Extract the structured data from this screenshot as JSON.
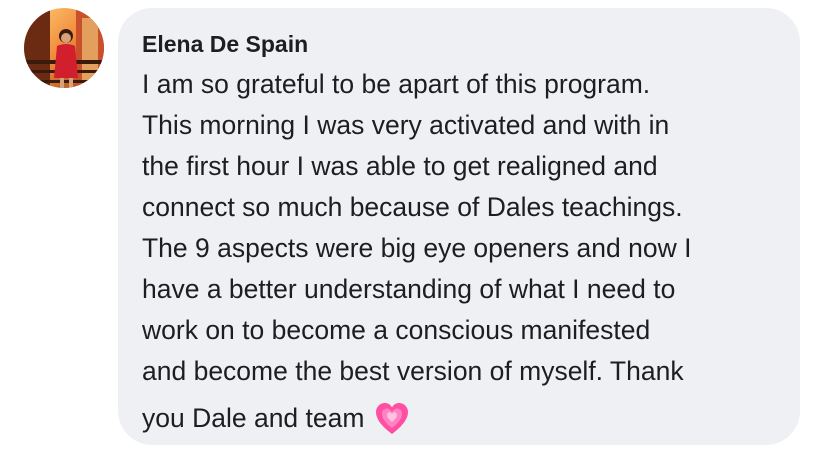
{
  "comment": {
    "author": "Elena De Spain",
    "lines": [
      "I am so grateful to be apart of this program.",
      "This morning I was very activated and with in",
      "the first hour I was able to get realigned and",
      "connect so much because of Dales teachings.",
      "The 9 aspects were big eye openers and now I",
      "have a better understanding of what I need to",
      "work on to become a conscious manifested",
      "and become the best version of myself. Thank"
    ],
    "last_line": "you Dale and team",
    "emoji": "growing-heart-icon"
  },
  "colors": {
    "bubble": "#eff0f3",
    "text": "#1c1e21",
    "heart": "#ff4fa3"
  }
}
